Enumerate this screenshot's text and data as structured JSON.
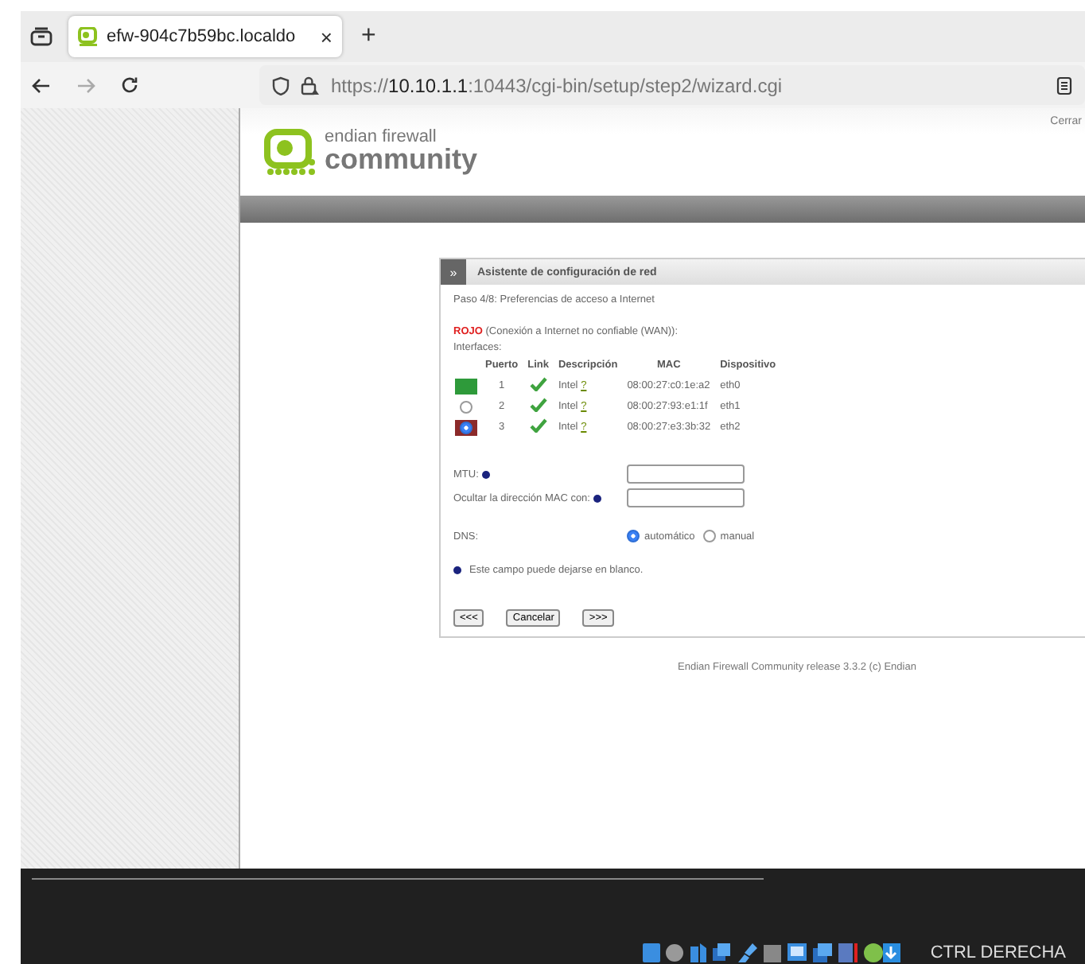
{
  "browser": {
    "tab": {
      "title": "efw-904c7b59bc.localdo",
      "close": "×",
      "selected": true
    },
    "new_tab": "+",
    "url": "https://**10.10.1.1**:10443/cgi-bin/setup/step2/wizard.cgi"
  },
  "header": {
    "logo_top": "endian firewall",
    "logo_bottom": "community",
    "logout": "Cerrar"
  },
  "panel": {
    "toggle": "»",
    "title": "Asistente de configuración de red",
    "step": "Paso 4/8: Preferencias de acceso a Internet",
    "zone": "ROJO",
    "zone_desc": "(Conexión a Internet no confiable (WAN)):",
    "interfaces_label": "Interfaces:",
    "columns": [
      "Puerto",
      "Link",
      "Descripción",
      "MAC",
      "Dispositivo"
    ],
    "rows": [
      {
        "kind": "assigned",
        "color": "#2e9a3a",
        "port": "1",
        "link": true,
        "desc": "Intel",
        "help": "?",
        "mac": "08:00:27:c0:1e:a2",
        "device": "eth0"
      },
      {
        "kind": "radio",
        "selected": false,
        "port": "2",
        "link": true,
        "desc": "Intel",
        "help": "?",
        "mac": "08:00:27:93:e1:1f",
        "device": "eth1"
      },
      {
        "kind": "radio",
        "color": "#8b2a2a",
        "selected": true,
        "port": "3",
        "link": true,
        "desc": "Intel",
        "help": "?",
        "mac": "08:00:27:e3:3b:32",
        "device": "eth2"
      }
    ],
    "fields": [
      {
        "label": "MTU:",
        "optional": true
      },
      {
        "label": "Ocultar la dirección MAC con:",
        "optional": true
      }
    ],
    "dns": {
      "label": "DNS:",
      "options": [
        {
          "label": "automático",
          "selected": true
        },
        {
          "label": "manual",
          "selected": false
        }
      ]
    },
    "note": "Este campo puede dejarse en blanco.",
    "buttons": [
      "<<<",
      "Cancelar",
      ">>>"
    ]
  },
  "footer": "Endian Firewall Community release 3.3.2 (c) Endian",
  "host_status": {
    "key_label": "CTRL DERECHA"
  }
}
